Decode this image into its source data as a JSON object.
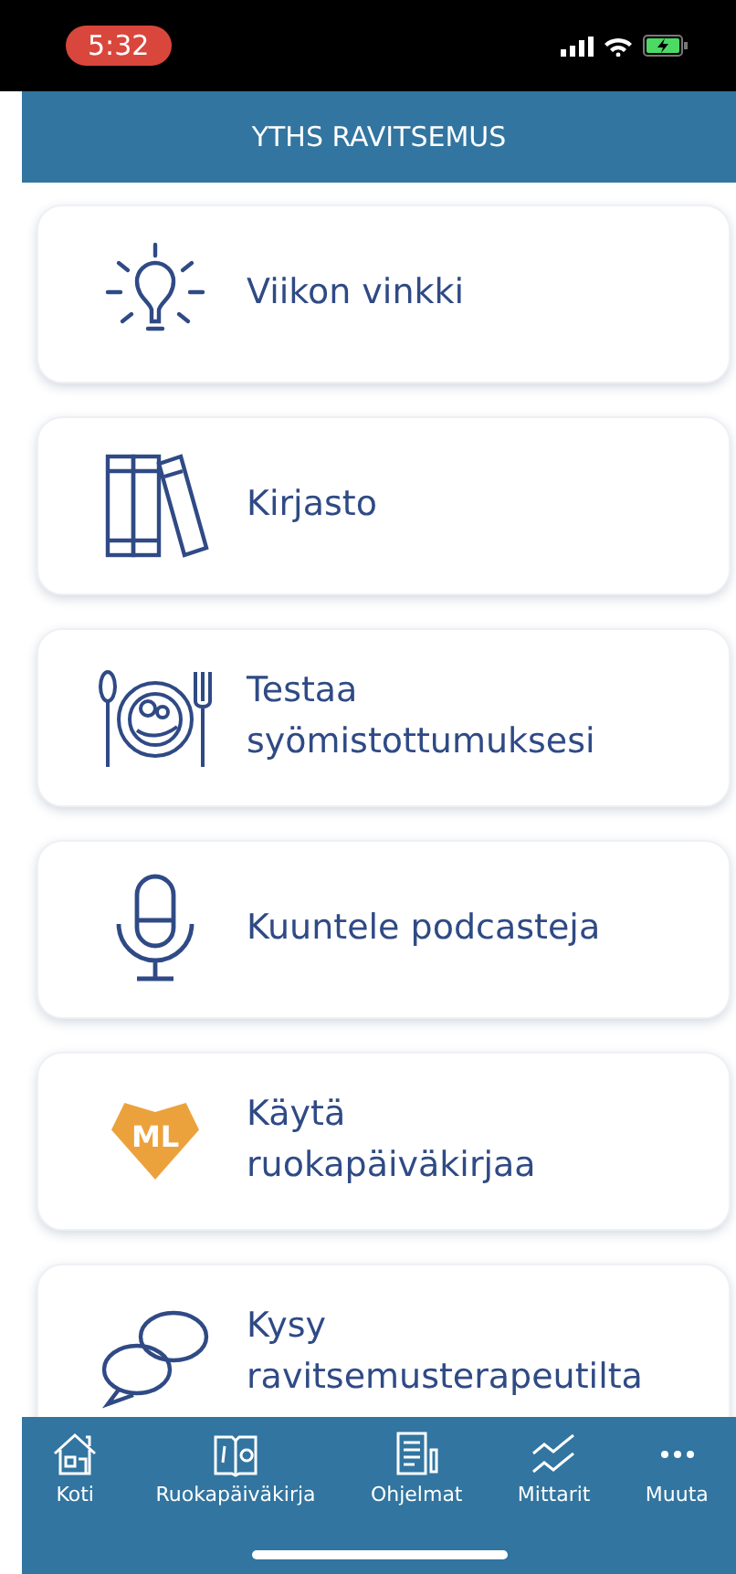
{
  "status_bar": {
    "time": "5:32"
  },
  "header": {
    "title": "YTHS RAVITSEMUS"
  },
  "menu": [
    {
      "kind": "bulb",
      "label": "Viikon vinkki"
    },
    {
      "kind": "books",
      "label": "Kirjasto"
    },
    {
      "kind": "plate",
      "label": "Testaa\nsyömistottumuksesi"
    },
    {
      "kind": "mic",
      "label": "Kuuntele podcasteja"
    },
    {
      "kind": "badge",
      "badge_text": "ML",
      "label": "Käytä\nruokapäiväkirjaa"
    },
    {
      "kind": "chat",
      "label": "Kysy\nravitsemusterapeutilta"
    }
  ],
  "tab_bar": [
    {
      "kind": "home",
      "label": "Koti"
    },
    {
      "kind": "diary",
      "label": "Ruokapäiväkirja"
    },
    {
      "kind": "programs",
      "label": "Ohjelmat"
    },
    {
      "kind": "meters",
      "label": "Mittarit"
    },
    {
      "kind": "more",
      "label": "Muuta"
    }
  ]
}
